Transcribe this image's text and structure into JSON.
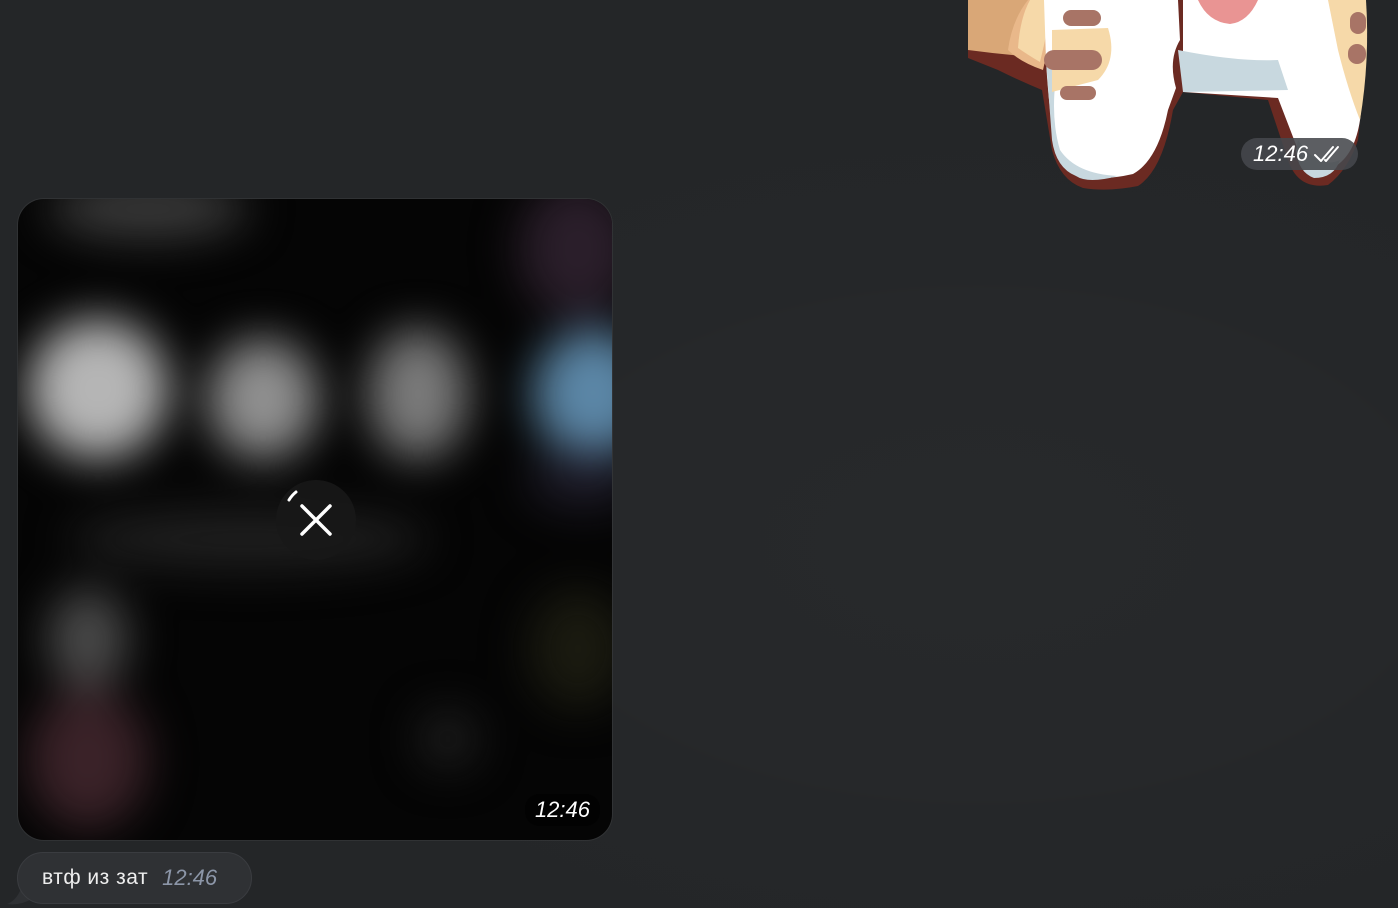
{
  "sticker_message": {
    "time": "12:46",
    "status_icon": "double-check-icon",
    "sticker_icon": "cat-sticker-icon"
  },
  "media_message": {
    "time": "12:46",
    "cancel_icon": "close-icon"
  },
  "text_message": {
    "text": "втф из зат",
    "time": "12:46"
  },
  "colors": {
    "background": "#242628",
    "bubble": "#2f3134",
    "time_meta": "#8c96a8",
    "sticker_outline": "#6b2a22"
  }
}
